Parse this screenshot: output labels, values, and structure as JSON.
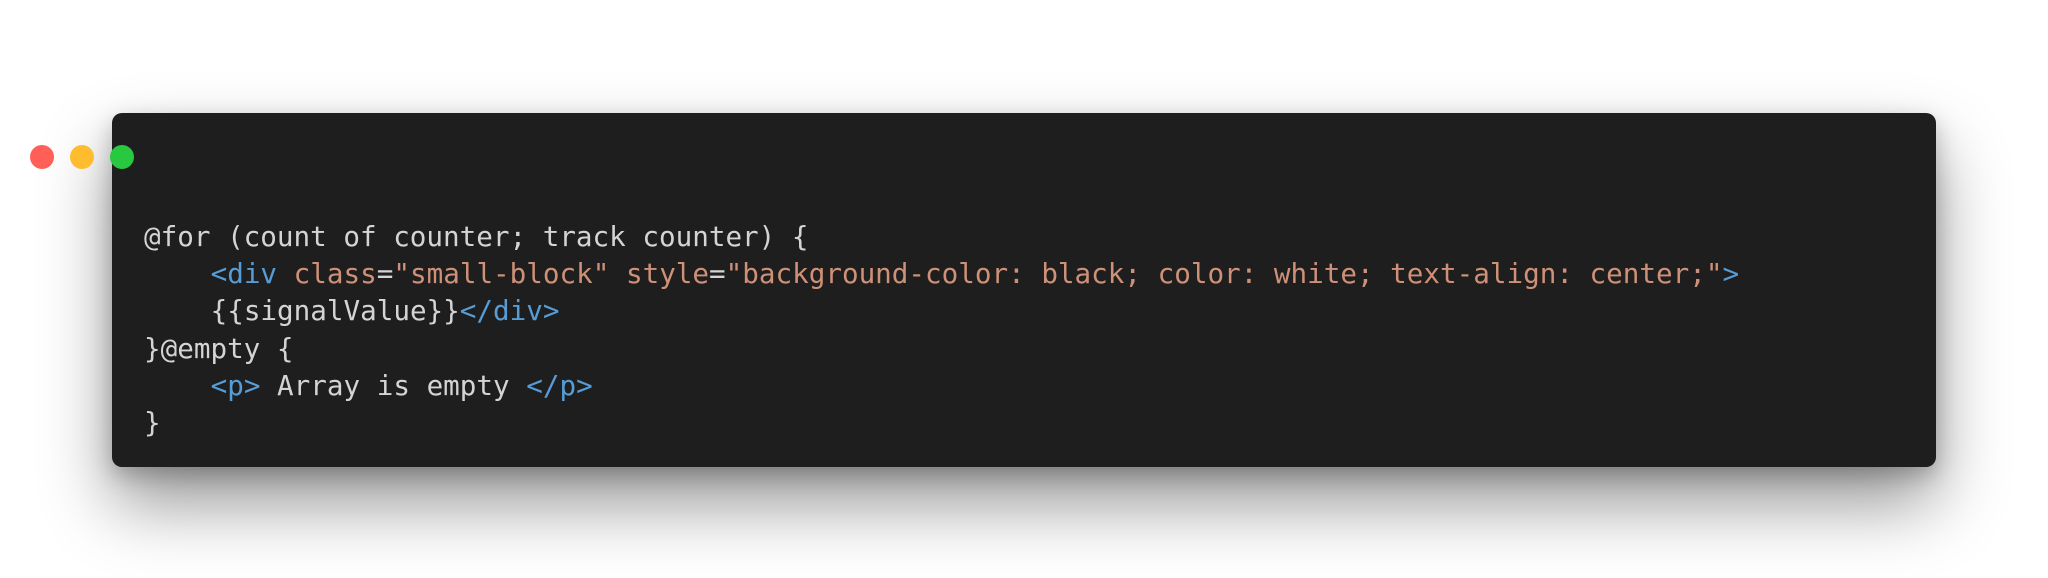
{
  "window": {
    "controls": {
      "close": "traffic-light-red",
      "minimize": "traffic-light-yellow",
      "maximize": "traffic-light-green"
    }
  },
  "code": {
    "line1": "@for (count of counter; track counter) {",
    "line2": {
      "tag_open": "<div",
      "attr1_name": "class",
      "attr1_eq": "=",
      "attr1_value": "\"small-block\"",
      "attr2_name": "style",
      "attr2_eq": "=",
      "attr2_value": "\"background-color: black; color: white; text-align: center;\"",
      "tag_close": ">"
    },
    "line3": {
      "text": "{{signalValue}}",
      "tag_end": "</div>"
    },
    "line4": "}@empty {",
    "line5": {
      "tag_open": "<p>",
      "text": " Array is empty ",
      "tag_close": "</p>"
    },
    "line6": "}"
  },
  "colors": {
    "background": "#1e1e1e",
    "text": "#d4d4d4",
    "tag": "#569cd6",
    "attribute": "#ce9178",
    "string": "#ce9178",
    "close": "#ff5f57",
    "minimize": "#febc2e",
    "maximize": "#28c840"
  }
}
